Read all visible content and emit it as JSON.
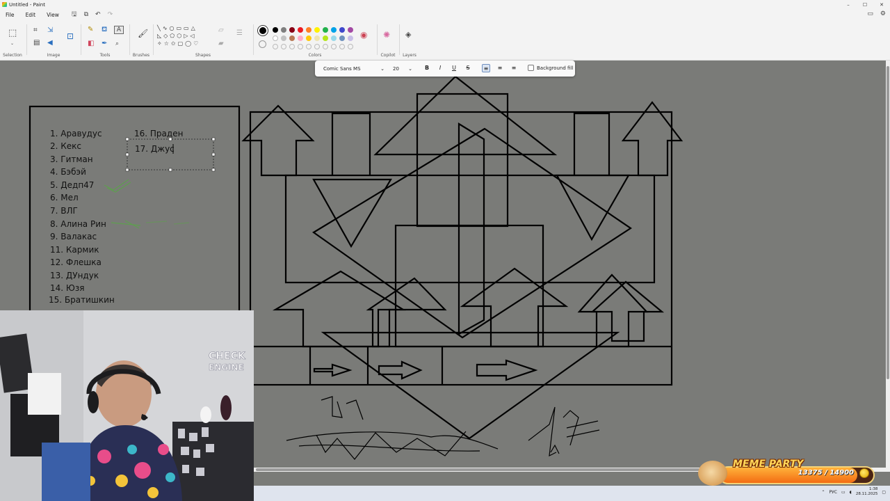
{
  "window": {
    "title": "Untitled - Paint",
    "controls": [
      "–",
      "☐",
      "✕"
    ]
  },
  "menu": {
    "items": [
      "File",
      "Edit",
      "View"
    ],
    "quick_actions": [
      "save-icon",
      "share-icon",
      "undo-icon",
      "redo-icon"
    ]
  },
  "ribbon": {
    "groups": [
      "Selection",
      "Image",
      "Tools",
      "Brushes",
      "Shapes",
      "Colors",
      "Copilot",
      "Layers"
    ],
    "selected_color": "#000000",
    "palette": [
      "#000000",
      "#7f7f7f",
      "#880015",
      "#ed1c24",
      "#ff7f27",
      "#fff200",
      "#22b14c",
      "#00a2e8",
      "#3f48cc",
      "#a349a4",
      "#ffffff",
      "#c3c3c3",
      "#b97a57",
      "#ffaec9",
      "#ffc90e",
      "#efe4b0",
      "#b5e61d",
      "#99d9ea",
      "#7092be",
      "#c8bfe7"
    ]
  },
  "textbar": {
    "font": "Comic Sans MS",
    "size": "20",
    "bold": "B",
    "italic": "I",
    "underline": "U",
    "strike": "S",
    "background_fill": "Background fill"
  },
  "canvas": {
    "list_left": [
      "1. Аравудус",
      "2. Кекс",
      "3. Гитман",
      "4. Бэбэй",
      "5. Дедп47",
      "6. Мел",
      "7. ВЛГ",
      "8. Алина Рин",
      "9. Валакас",
      "11. Кармик",
      "12. Флешка",
      "13. ДУндук",
      "14. Юзя",
      "15. Братишкин"
    ],
    "list_right": [
      "16. Праден",
      "17. Джус"
    ]
  },
  "taskbar": {
    "lang": "РУС",
    "time": "1:38",
    "date": "28.11.2025"
  },
  "widget": {
    "title": "MEME PARTY",
    "count": "13375 / 14900",
    "progress": 0.8977
  }
}
